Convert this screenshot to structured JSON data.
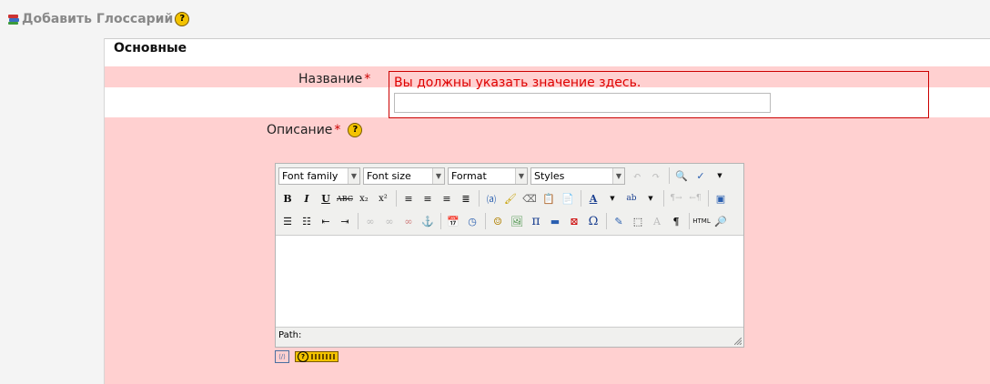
{
  "header": {
    "title": "Добавить Глоссарий",
    "icon": "glossary-icon"
  },
  "form": {
    "section_title": "Основные",
    "name_label": "Название",
    "required_mark": "*",
    "name_error": "Вы должны указать значение здесь.",
    "name_value": "",
    "description_label": "Описание"
  },
  "editor": {
    "font_family": "Font family",
    "font_size": "Font size",
    "format": "Format",
    "styles": "Styles",
    "path_label": "Path:"
  },
  "colors": {
    "error": "#cc0000",
    "error_bg": "#ffd0d0",
    "help": "#f3c300"
  }
}
